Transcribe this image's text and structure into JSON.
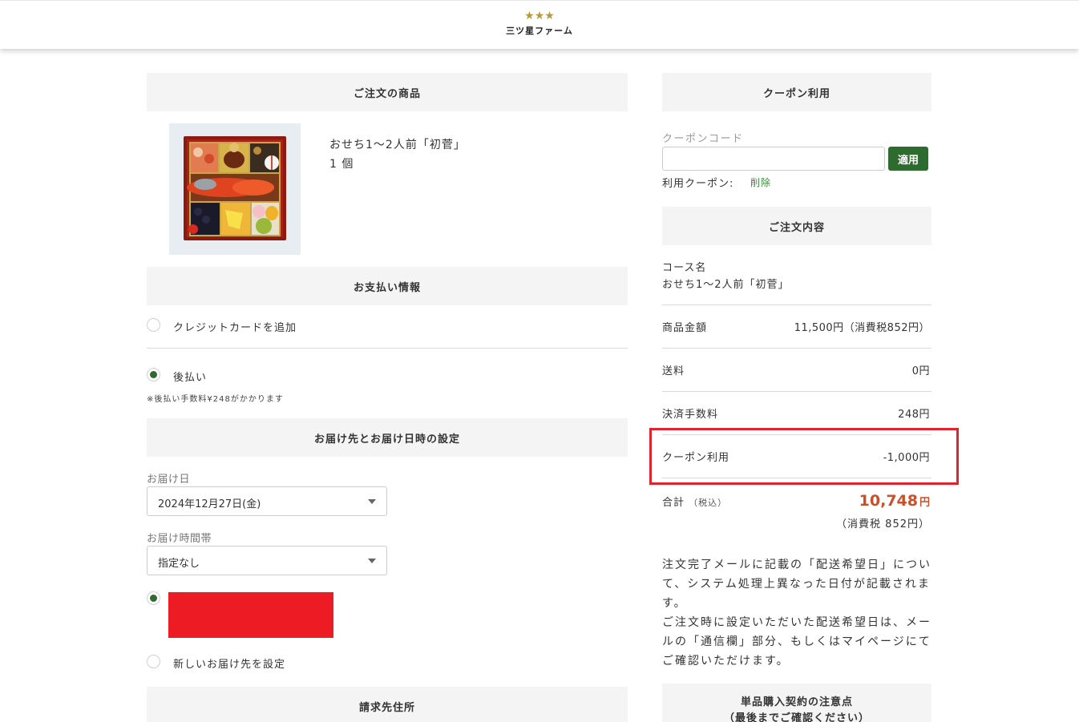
{
  "brand": {
    "stars": "★★★",
    "name": "三ツ星ファーム"
  },
  "order_items": {
    "heading": "ご注文の商品",
    "product_name": "おせち1〜2人前「初菅」",
    "quantity": "1 個"
  },
  "payment": {
    "heading": "お支払い情報",
    "option_credit": "クレジットカードを追加",
    "option_deferred": "後払い",
    "deferred_note": "※後払い手数料¥248がかかります",
    "selected": "後払い"
  },
  "delivery": {
    "heading": "お届け先とお届け日時の設定",
    "date_label": "お届け日",
    "date_value": "2024年12月27日(金)",
    "time_label": "お届け時間帯",
    "time_value": "指定なし",
    "new_address": "新しいお届け先を設定"
  },
  "billing": {
    "heading": "請求先住所"
  },
  "coupon": {
    "heading": "クーポン利用",
    "code_label": "クーポンコード",
    "code_value": "",
    "apply_label": "適用",
    "used_label": "利用クーポン:",
    "delete_label": "削除"
  },
  "summary": {
    "heading": "ご注文内容",
    "course_label": "コース名",
    "course_name": "おせち1〜2人前「初菅」",
    "rows": [
      {
        "label": "商品金額",
        "value": "11,500円（消費税852円）"
      },
      {
        "label": "送料",
        "value": "0円"
      },
      {
        "label": "決済手数料",
        "value": "248円"
      },
      {
        "label": "クーポン利用",
        "value": "-1,000円"
      }
    ],
    "total_label": "合計",
    "total_tax_in": "（税込）",
    "total_value": "10,748",
    "total_unit": "円",
    "total_tax": "（消費税 852円）"
  },
  "notice": {
    "line1": "注文完了メールに記載の「配送希望日」について、システム処理上異なった日付が記載されます。",
    "line2": "ご注文時に設定いただいた配送希望日は、メールの「通信欄」部分、もしくはマイページにてご確認いただけます。"
  },
  "contract": {
    "title": "単品購入契約の注意点",
    "subtitle": "（最後までご確認ください）"
  },
  "colors": {
    "accent_green": "#2e6b2e",
    "total_orange": "#c9502a",
    "highlight_red": "#e0242f",
    "redaction_red": "#ed1c24"
  }
}
